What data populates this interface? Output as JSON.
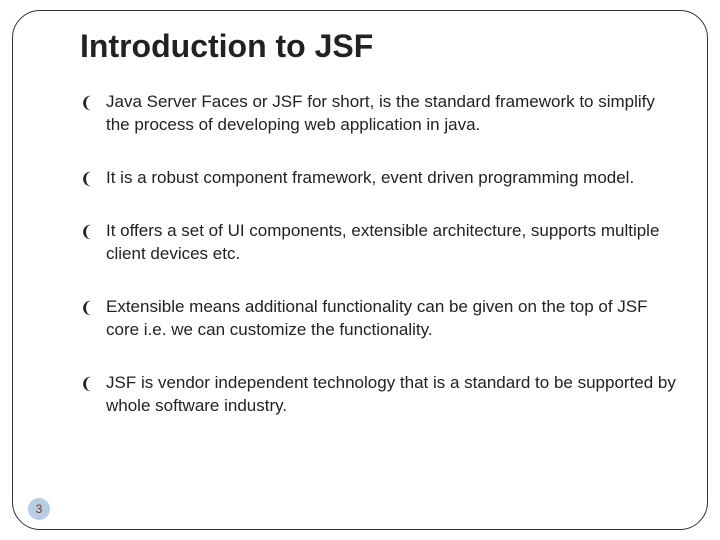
{
  "title": "Introduction to JSF",
  "bullets": [
    "Java Server Faces or JSF for short, is the standard framework to simplify the process of developing web application in java.",
    "It is a robust component framework, event driven programming model.",
    "It offers a set of UI components, extensible architecture, supports multiple client devices etc.",
    "Extensible means additional functionality can be given on the top of JSF core i.e. we can customize the functionality.",
    "JSF is vendor independent technology that is  a standard to be supported by whole software industry."
  ],
  "page_number": "3",
  "bullet_glyph": "❨"
}
